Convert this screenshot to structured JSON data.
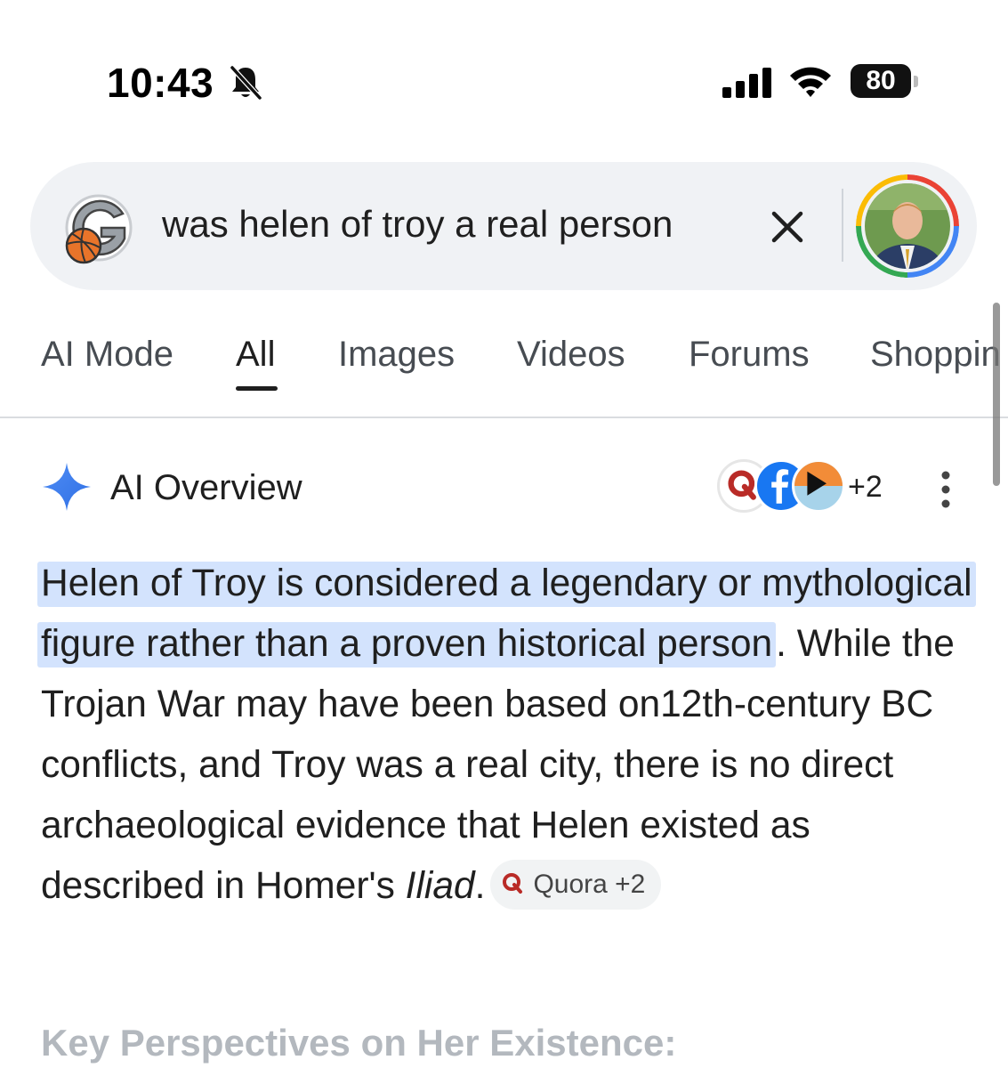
{
  "status_bar": {
    "time": "10:43",
    "battery": "80",
    "icons": [
      "bell-slash-icon",
      "cellular-signal-icon",
      "wifi-icon",
      "battery-icon"
    ]
  },
  "search": {
    "query": "was helen of troy a real person",
    "icons": [
      "gamecast-logo",
      "clear-icon",
      "profile-avatar"
    ]
  },
  "tabs": [
    {
      "label": "AI Mode",
      "active": false
    },
    {
      "label": "All",
      "active": true
    },
    {
      "label": "Images",
      "active": false
    },
    {
      "label": "Videos",
      "active": false
    },
    {
      "label": "Forums",
      "active": false
    },
    {
      "label": "Shoppin",
      "active": false
    }
  ],
  "ai_overview": {
    "title": "AI Overview",
    "sources_more": "+2",
    "source_icons": [
      "quora-icon",
      "facebook-icon",
      "video-source-icon"
    ],
    "highlighted_text": "Helen of Troy is considered a legendary or mythological figure rather than a proven historical person",
    "body_text": ". While the Trojan War may have been based on12th-century BC conflicts, and Troy was a real city, there is no direct archaeological evidence that Helen existed as described in Homer's ",
    "italic_text": "Iliad",
    "tail_text": ".",
    "chip_label": "Quora +2"
  },
  "section_heading": "Key Perspectives on Her Existence:",
  "colors": {
    "highlight": "#d3e3fd",
    "search_bg": "#f0f2f5",
    "gemini_blue": "#4285f4",
    "quora_red": "#b92b27",
    "facebook_blue": "#1877f2"
  }
}
